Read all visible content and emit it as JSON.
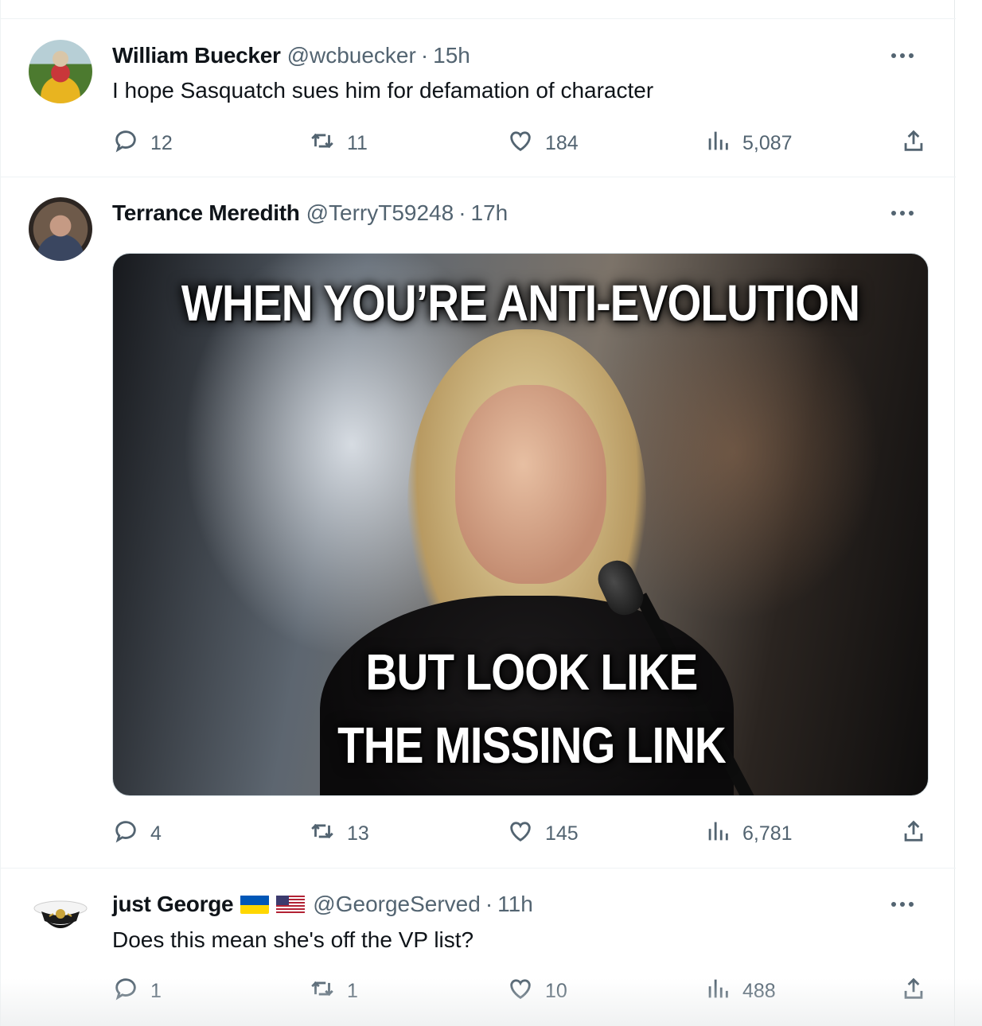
{
  "tweets": [
    {
      "name": "William Buecker",
      "handle": "@wcbuecker",
      "sep": "·",
      "time": "15h",
      "text": "I hope Sasquatch sues him for defamation of character",
      "replies": "12",
      "retweets": "11",
      "likes": "184",
      "views": "5,087"
    },
    {
      "name": "Terrance Meredith",
      "handle": "@TerryT59248",
      "sep": "·",
      "time": "17h",
      "media": {
        "top_text": "WHEN YOU’RE ANTI-EVOLUTION",
        "bottom_line_1": "BUT LOOK LIKE",
        "bottom_line_2": "THE MISSING LINK"
      },
      "replies": "4",
      "retweets": "13",
      "likes": "145",
      "views": "6,781"
    },
    {
      "name": "just George",
      "handle": "@GeorgeServed",
      "sep": "·",
      "time": "11h",
      "text": "Does this mean she's off the VP list?",
      "replies": "1",
      "retweets": "1",
      "likes": "10",
      "views": "488"
    }
  ],
  "icons": {
    "more": "more-dots-icon",
    "reply": "reply-bubble-icon",
    "retweet": "retweet-arrows-icon",
    "like": "heart-icon",
    "views": "views-bars-icon",
    "share": "share-upload-icon",
    "flags": [
      "ukraine-flag-icon",
      "us-flag-icon"
    ]
  },
  "colors": {
    "text_primary": "#0f1419",
    "text_secondary": "#536471",
    "border": "#eff3f4",
    "flag_ukraine_blue": "#0057b7",
    "flag_ukraine_yellow": "#ffd700",
    "flag_us_red": "#b22234",
    "flag_us_blue": "#3c3b6e"
  }
}
